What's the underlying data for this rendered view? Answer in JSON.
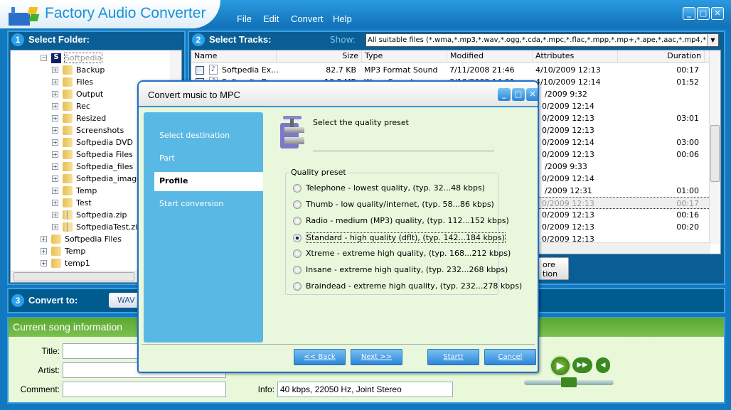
{
  "app": {
    "title": "Factory Audio Converter",
    "menu": [
      "File",
      "Edit",
      "Convert",
      "Help"
    ],
    "window_buttons": [
      "minimize",
      "maximize",
      "close"
    ]
  },
  "folders": {
    "step": "1",
    "header": "Select Folder:",
    "root": "Softpedia",
    "children": [
      "Backup",
      "Files",
      "Output",
      "Rec",
      "Resized",
      "Screenshots",
      "Softpedia DVD",
      "Softpedia Files",
      "Softpedia_files",
      "Softpedia_images",
      "Temp",
      "Test",
      "Softpedia.zip",
      "SoftpediaTest.zip"
    ],
    "siblings": [
      "Softpedia Files",
      "Temp",
      "temp1"
    ]
  },
  "tracks": {
    "step": "2",
    "header": "Select Tracks:",
    "show_label": "Show:",
    "filter": "All suitable files (*.wma,*.mp3,*.wav,*.ogg,*.cda,*.mpc,*.flac,*.mpp,*.mp+,*.ape,*.aac,*.mp4,*.m4a,*.of",
    "columns": [
      "Name",
      "Size",
      "Type",
      "Modified",
      "Attributes",
      "Duration"
    ],
    "rows": [
      {
        "name": "Softpedia Ex...",
        "size": "82.7 KB",
        "type": "MP3 Format Sound",
        "modified": "7/11/2008 21:46",
        "attributes": "4/10/2009 12:13",
        "duration": "00:17"
      },
      {
        "name": "Softpedia Be...",
        "size": "10.9 MB",
        "type": "Wave Sound",
        "modified": "3/10/2009 14:01",
        "attributes": "4/10/2009 12:14",
        "duration": "01:52"
      },
      {
        "attributes": "/2009 9:32",
        "duration": ""
      },
      {
        "attributes": "0/2009 12:14",
        "duration": ""
      },
      {
        "attributes": "0/2009 12:13",
        "duration": "03:01"
      },
      {
        "attributes": "0/2009 12:13",
        "duration": ""
      },
      {
        "attributes": "0/2009 12:14",
        "duration": "03:00"
      },
      {
        "attributes": "0/2009 12:13",
        "duration": "00:06"
      },
      {
        "attributes": "/2009 9:33",
        "duration": ""
      },
      {
        "attributes": "0/2009 12:14",
        "duration": ""
      },
      {
        "attributes": "/2009 12:31",
        "duration": "01:00"
      },
      {
        "attributes": "0/2009 12:13",
        "duration": "00:17"
      },
      {
        "attributes": "0/2009 12:13",
        "duration": "00:16"
      },
      {
        "attributes": "0/2009 12:13",
        "duration": "00:20"
      },
      {
        "attributes": "0/2009 12:13",
        "duration": ""
      }
    ],
    "more_button": "ore\ntion"
  },
  "convert": {
    "step": "3",
    "header": "Convert to:",
    "format": "WAV"
  },
  "song": {
    "header": "Current song information",
    "title_label": "Title:",
    "artist_label": "Artist:",
    "comment_label": "Comment:",
    "info_label": "Info:",
    "info_value": "40 kbps, 22050 Hz, Joint Stereo",
    "title": "",
    "artist": "",
    "comment": ""
  },
  "player": {
    "position_percent": 50
  },
  "dialog": {
    "title": "Convert music to MPC",
    "steps": [
      "Select destination",
      "Part",
      "Profile",
      "Start conversion"
    ],
    "active_step": 2,
    "heading": "Select the quality preset",
    "group_label": "Quality preset",
    "presets": [
      "Telephone - lowest quality, (typ.  32...48 kbps)",
      "Thumb  - low quality/internet, (typ.  58...86 kbps)",
      "Radio - medium (MP3) quality, (typ. 112...152 kbps)",
      "Standard - high quality (dflt),  (typ. 142...184 kbps)",
      "Xtreme - extreme high quality, (typ. 168...212 kbps)",
      "Insane - extreme high quality, (typ. 232...268 kbps)",
      "Braindead - extreme high quality, (typ. 232...278 kbps)"
    ],
    "selected_preset": 3,
    "buttons": {
      "back": "<< Back",
      "next": "Next >>",
      "start": "Start!",
      "cancel": "Cancel"
    }
  },
  "colors": {
    "frame": "#1278c0",
    "panel": "#0a5e96",
    "green_header": "#5aa830",
    "song_bg": "#e8f8d8",
    "steps_bg": "#5ab8e4"
  }
}
